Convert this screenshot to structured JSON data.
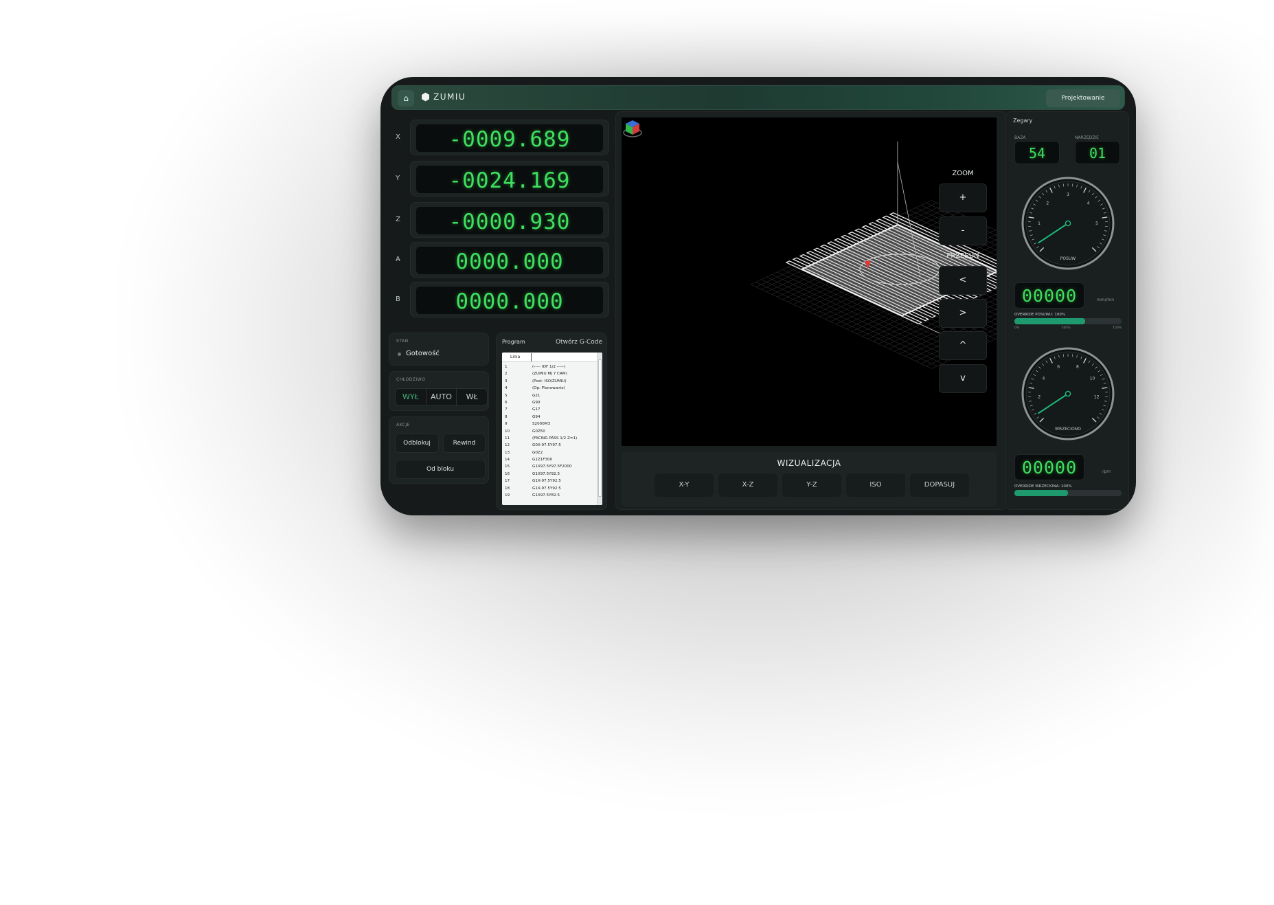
{
  "header": {
    "brand": "ZUMIU",
    "mode_button": "Projektowanie"
  },
  "axes": [
    {
      "label": "X",
      "value": "-0009.689"
    },
    {
      "label": "Y",
      "value": "-0024.169"
    },
    {
      "label": "Z",
      "value": "-0000.930"
    },
    {
      "label": "A",
      "value": "0000.000"
    },
    {
      "label": "B",
      "value": "0000.000"
    }
  ],
  "status": {
    "title": "STAN",
    "value": "Gotowość"
  },
  "coolant": {
    "title": "CHŁODZIWO",
    "options": [
      "WYŁ",
      "AUTO",
      "WŁ"
    ],
    "selected": "WYŁ"
  },
  "actions": {
    "title": "AKCJE",
    "unlock": "Odblokuj",
    "rewind": "Rewind",
    "from_block": "Od bloku"
  },
  "program": {
    "title": "Program",
    "open_button": "Otwórz G-Code",
    "column": "Linia",
    "lines": [
      {
        "n": "1",
        "code": "(----- IDF 1/2 -----)"
      },
      {
        "n": "2",
        "code": "(ZUMIU MJ 7 CAM)"
      },
      {
        "n": "3",
        "code": "(Post: ISO/ZUMIU)"
      },
      {
        "n": "4",
        "code": "(Op: Planowanie)"
      },
      {
        "n": "5",
        "code": "G21"
      },
      {
        "n": "6",
        "code": "G90"
      },
      {
        "n": "7",
        "code": "G17"
      },
      {
        "n": "8",
        "code": "G94"
      },
      {
        "n": "9",
        "code": "S2000M3"
      },
      {
        "n": "10",
        "code": "G0Z50"
      },
      {
        "n": "11",
        "code": "(FACING PASS 1/2  Z=1)"
      },
      {
        "n": "12",
        "code": "G0X-97.5Y97.5"
      },
      {
        "n": "13",
        "code": "G0Z2"
      },
      {
        "n": "14",
        "code": "G1Z1F300"
      },
      {
        "n": "15",
        "code": "G1X97.5Y97.5F2000"
      },
      {
        "n": "16",
        "code": "G1X97.5Y92.5"
      },
      {
        "n": "17",
        "code": "G1X-97.5Y92.5"
      },
      {
        "n": "18",
        "code": "G1X-97.5Y92.5"
      },
      {
        "n": "19",
        "code": "G1X97.5Y82.5"
      }
    ]
  },
  "viz": {
    "zoom_label": "ZOOM",
    "zoom_in": "+",
    "zoom_out": "-",
    "pan_label": "PRZESUŃ",
    "pan_left": "<",
    "pan_right": ">",
    "pan_up": "^",
    "pan_down": "v",
    "title": "WIZUALIZACJA",
    "views": [
      "X-Y",
      "X-Z",
      "Y-Z",
      "ISO",
      "DOPASUJ"
    ]
  },
  "clocks": {
    "title": "Zegary",
    "base_label": "BAZA",
    "base_value": "54",
    "tool_label": "NARZĘDZIE",
    "tool_value": "01",
    "feed_gauge_label": "POSUW",
    "feed_gauge_ticks": [
      "1",
      "2",
      "3",
      "4",
      "5"
    ],
    "feed_value": "00000",
    "feed_unit": "mm/min",
    "feed_override_label": "OVERRIDE POSUWU: 100%",
    "feed_override_fraction": 0.66,
    "override_ticks": [
      "0%",
      "100%",
      "150%"
    ],
    "spindle_gauge_label": "WRZECIONO",
    "spindle_gauge_ticks": [
      "2",
      "4",
      "6",
      "8",
      "10",
      "12"
    ],
    "spindle_value": "00000",
    "spindle_unit": "rpm",
    "spindle_override_label": "OVERRIDE WRZECIONA: 100%",
    "spindle_override_fraction": 0.5
  },
  "colors": {
    "segment_green": "#3ee05e",
    "accent_green": "#1f9a6e",
    "background": "#161a1b"
  }
}
